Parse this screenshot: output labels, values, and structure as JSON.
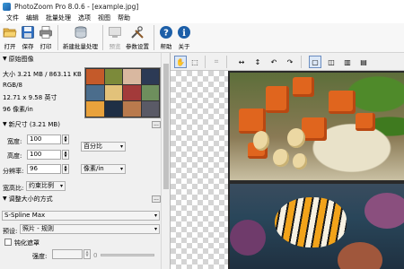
{
  "app": {
    "title": "PhotoZoom Pro 8.0.6 - [example.jpg]"
  },
  "menu": [
    "文件",
    "编辑",
    "批量处理",
    "选项",
    "视图",
    "帮助"
  ],
  "toolbar": [
    {
      "label": "打开",
      "icon": "open-folder-icon",
      "disabled": false
    },
    {
      "label": "保存",
      "icon": "save-disk-icon",
      "disabled": false
    },
    {
      "label": "打印",
      "icon": "printer-icon",
      "disabled": false
    },
    {
      "label": "新建批量处理",
      "icon": "batch-stack-icon",
      "disabled": false
    },
    {
      "label": "预览",
      "icon": "preview-icon",
      "disabled": true
    },
    {
      "label": "参数设置",
      "icon": "tools-icon",
      "disabled": false
    },
    {
      "label": "帮助",
      "icon": "help-icon",
      "disabled": false
    },
    {
      "label": "关于",
      "icon": "info-icon",
      "disabled": false
    }
  ],
  "original": {
    "header": "原始图像",
    "size": "大小 3.21 MB / 863.11 KB",
    "mode": "RGB/8",
    "dimensions": "12.71 x 9.58 英寸",
    "resolution": "96 像素/in"
  },
  "newsize": {
    "header": "新尺寸 (3.21 MB)",
    "width_label": "宽度:",
    "width_value": "100",
    "height_label": "高度:",
    "height_value": "100",
    "unit_percent": "百分比",
    "resolution_label": "分辨率:",
    "resolution_value": "96",
    "resolution_unit": "像素/in",
    "aspect_label": "宽高比:",
    "aspect_value": "约束比例"
  },
  "method": {
    "header": "调整大小的方式",
    "algorithm": "S-Spline Max",
    "preset_label": "预设:",
    "preset_value": "照片 - 规则",
    "sharpen_label": "钝化遮罩",
    "strength_label": "强度:",
    "strength_value": "0"
  },
  "colors": {
    "accent": "#1d5fa8",
    "canvas_check": "#d4d4d4"
  }
}
